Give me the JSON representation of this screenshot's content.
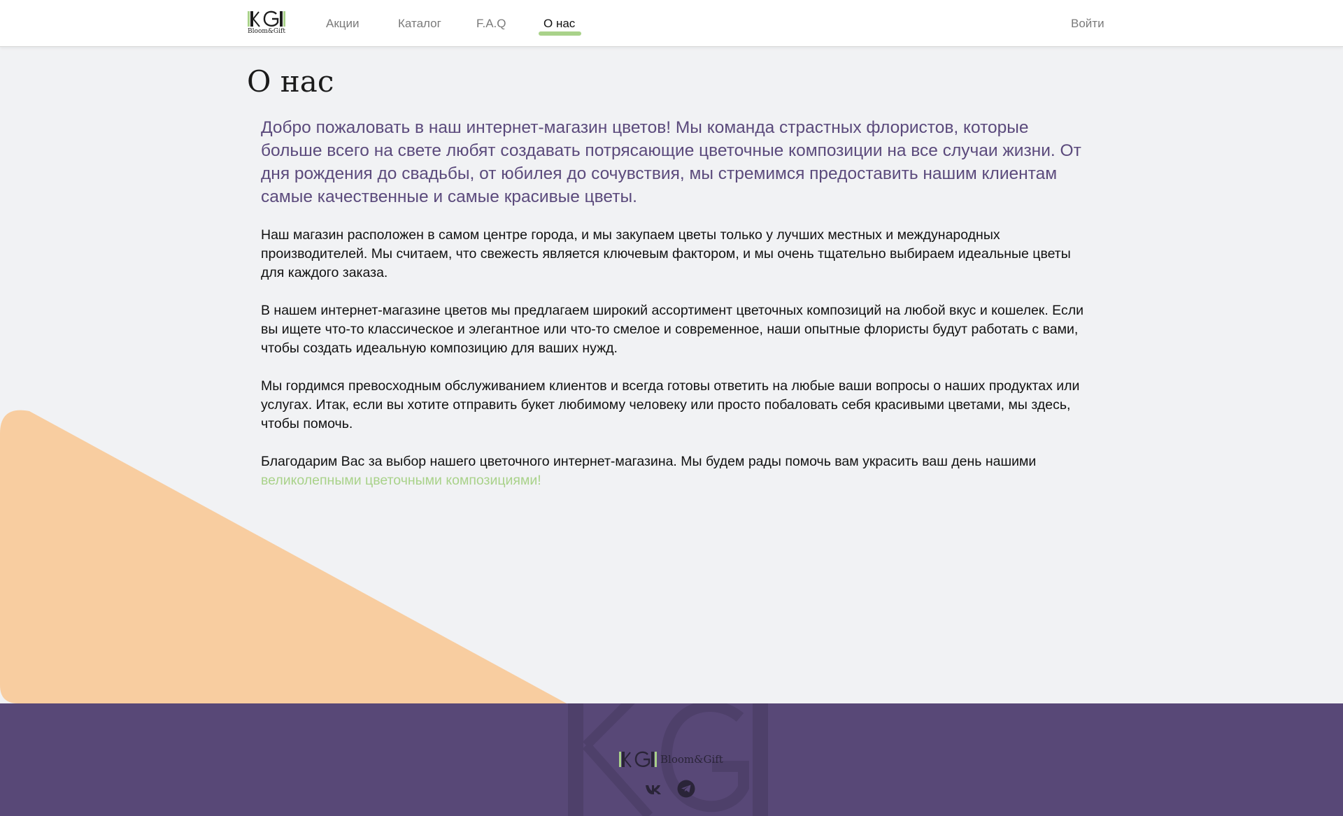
{
  "brand": {
    "name": "Bloom&Gift",
    "mark": "BG",
    "colors": {
      "accent_green": "#a9d28a",
      "purple": "#584877",
      "peach": "#f8cda0"
    }
  },
  "nav": {
    "items": [
      {
        "label": "Акции"
      },
      {
        "label": "Каталог"
      },
      {
        "label": "F.A.Q"
      },
      {
        "label": "О нас",
        "active": true
      }
    ],
    "login_label": "Войти"
  },
  "main": {
    "title": "О нас",
    "lead": "Добро пожаловать в наш интернет-магазин цветов! Мы команда страстных флористов, которые больше всего на свете любят создавать потрясающие цветочные композиции на все случаи жизни. От дня рождения до свадьбы, от юбилея до сочувствия, мы стремимся предоставить нашим клиентам самые качественные и самые красивые цветы.",
    "paragraphs": [
      "Наш магазин расположен в самом центре города, и мы закупаем цветы только у лучших местных и международных производителей. Мы считаем, что свежесть является ключевым фактором, и мы очень тщательно выбираем идеальные цветы для каждого заказа.",
      "В нашем интернет-магазине цветов мы предлагаем широкий ассортимент цветочных композиций на любой вкус и кошелек. Если вы ищете что-то классическое и элегантное или что-то смелое и современное, наши опытные флористы будут работать с вами, чтобы создать идеальную композицию для ваших нужд.",
      "Мы гордимся превосходным обслуживанием клиентов и всегда готовы ответить на любые ваши вопросы о наших продуктах или услугах. Итак, если вы хотите отправить букет любимому человеку или просто побаловать себя красивыми цветами, мы здесь, чтобы помочь."
    ],
    "closing_text": "Благодарим Вас за выбор нашего цветочного интернет-магазина. Мы будем рады помочь вам украсить ваш день нашими ",
    "closing_link": "великолепными цветочными композициями!"
  },
  "footer": {
    "brand_name": "Bloom&Gift",
    "socials": [
      {
        "icon": "vk-icon"
      },
      {
        "icon": "telegram-icon"
      }
    ]
  }
}
